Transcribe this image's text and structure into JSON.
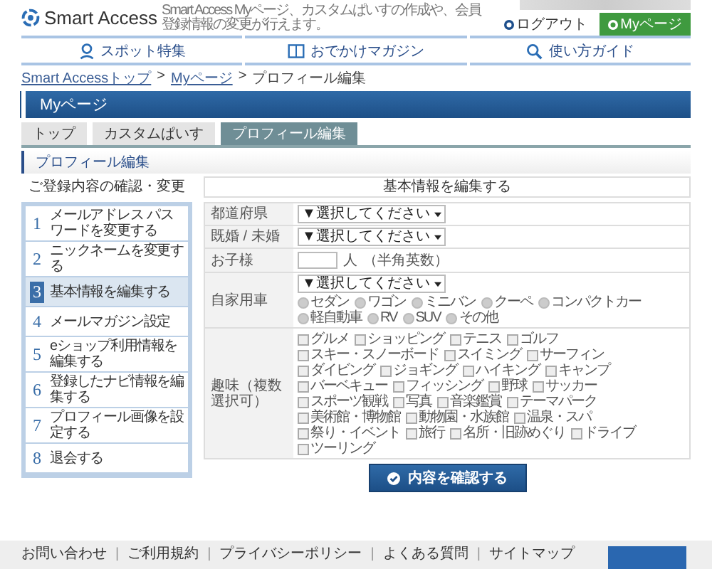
{
  "header": {
    "logo": "Smart Access",
    "tagline": "Smart Access Myページ、カスタムぱいすの作成や、会員登録情報の変更が行えます。",
    "logout": "ログアウト",
    "mypage_button": "Myページ"
  },
  "nav": [
    {
      "label": "スポット特集",
      "kind": "pin"
    },
    {
      "label": "おでかけマガジン",
      "kind": "book"
    },
    {
      "label": "使い方ガイド",
      "kind": "search"
    }
  ],
  "breadcrumb": [
    {
      "kind": "link",
      "label": "Smart Accessトップ"
    },
    {
      "kind": "separator",
      "label": ">"
    },
    {
      "kind": "link",
      "label": "Myページ"
    },
    {
      "kind": "separator",
      "label": ">"
    },
    {
      "kind": "current",
      "label": "プロフィール編集"
    }
  ],
  "page_title": "Myページ",
  "tabs": [
    {
      "label": "トップ",
      "selected": false
    },
    {
      "label": "カスタムぱいす",
      "selected": false
    },
    {
      "label": "プロフィール編集",
      "selected": true
    }
  ],
  "section_title": "プロフィール編集",
  "sidebar": {
    "heading": "ご登録内容の確認・変更",
    "items": [
      {
        "number": "1",
        "label": "メールアドレス パスワードを変更する",
        "selected": false
      },
      {
        "number": "2",
        "label": "ニックネームを変更する",
        "selected": false
      },
      {
        "number": "3",
        "label": "基本情報を編集する",
        "selected": true
      },
      {
        "number": "4",
        "label": "メールマガジン設定",
        "selected": false
      },
      {
        "number": "5",
        "label": "eショップ利用情報を編集する",
        "selected": false
      },
      {
        "number": "6",
        "label": "登録したナビ情報を編集する",
        "selected": false
      },
      {
        "number": "7",
        "label": "プロフィール画像を設定する",
        "selected": false
      },
      {
        "number": "8",
        "label": "退会する",
        "selected": false
      }
    ]
  },
  "form": {
    "heading": "基本情報を編集する",
    "rows": [
      {
        "label": "都道府県",
        "kind": "select",
        "value": "▼選択してください"
      },
      {
        "label": "既婚 / 未婚",
        "kind": "select",
        "value": "▼選択してください"
      },
      {
        "label": "お子様",
        "kind": "number",
        "unit": "人",
        "note": "（半角英数）"
      },
      {
        "label": "自家用車",
        "kind": "select_radio",
        "value": "▼選択してください",
        "options": [
          {
            "label": "セダン",
            "selected": false
          },
          {
            "label": "ワゴン",
            "selected": false
          },
          {
            "label": "ミニバン",
            "selected": false
          },
          {
            "label": "クーペ",
            "selected": false
          },
          {
            "label": "コンパクトカー",
            "selected": false
          },
          {
            "label": "軽自動車",
            "selected": false
          },
          {
            "label": "RV",
            "selected": false
          },
          {
            "label": "SUV",
            "selected": false
          },
          {
            "label": "その他",
            "selected": false
          }
        ]
      },
      {
        "label": "趣味（複数選択可）",
        "kind": "checkboxes",
        "options": [
          {
            "label": "グルメ",
            "checked": false
          },
          {
            "label": "ショッピング",
            "checked": false
          },
          {
            "label": "テニス",
            "checked": false
          },
          {
            "label": "ゴルフ",
            "checked": false
          },
          {
            "label": "スキー・スノーボード",
            "checked": false
          },
          {
            "label": "スイミング",
            "checked": false
          },
          {
            "label": "サーフィン",
            "checked": false
          },
          {
            "label": "ダイビング",
            "checked": false
          },
          {
            "label": "ジョギング",
            "checked": false
          },
          {
            "label": "ハイキング",
            "checked": false
          },
          {
            "label": "キャンプ",
            "checked": false
          },
          {
            "label": "バーベキュー",
            "checked": false
          },
          {
            "label": "フィッシング",
            "checked": false
          },
          {
            "label": "野球",
            "checked": false
          },
          {
            "label": "サッカー",
            "checked": false
          },
          {
            "label": "スポーツ観戦",
            "checked": false
          },
          {
            "label": "写真",
            "checked": false
          },
          {
            "label": "音楽鑑賞",
            "checked": false
          },
          {
            "label": "テーマパーク",
            "checked": false
          },
          {
            "label": "美術館・博物館",
            "checked": false
          },
          {
            "label": "動物園・水族館",
            "checked": false
          },
          {
            "label": "温泉・スパ",
            "checked": false
          },
          {
            "label": "祭り・イベント",
            "checked": false
          },
          {
            "label": "旅行",
            "checked": false
          },
          {
            "label": "名所・旧跡めぐり",
            "checked": false
          },
          {
            "label": "ドライブ",
            "checked": false
          },
          {
            "label": "ツーリング",
            "checked": false
          }
        ]
      }
    ],
    "submit": "内容を確認する"
  },
  "footer": {
    "links": [
      {
        "kind": "link",
        "label": "お問い合わせ"
      },
      {
        "kind": "separator",
        "label": "|"
      },
      {
        "kind": "link",
        "label": "ご利用規約"
      },
      {
        "kind": "separator",
        "label": "|"
      },
      {
        "kind": "link",
        "label": "プライバシーポリシー"
      },
      {
        "kind": "separator",
        "label": "|"
      },
      {
        "kind": "link",
        "label": "よくある質問"
      },
      {
        "kind": "separator",
        "label": "|"
      },
      {
        "kind": "link",
        "label": "サイトマップ"
      }
    ]
  }
}
